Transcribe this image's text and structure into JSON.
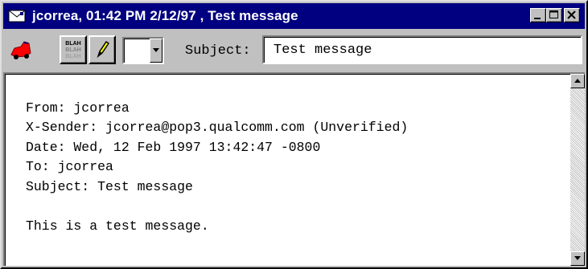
{
  "window": {
    "title": "jcorrea, 01:42 PM 2/12/97 , Test message",
    "title_icon": "envelope-icon",
    "buttons": [
      "minimize-icon",
      "maximize-icon",
      "close-icon"
    ]
  },
  "toolbar": {
    "tools": [
      {
        "name": "priority-car-icon"
      },
      {
        "name": "blah-blah-icon"
      },
      {
        "name": "pencil-edit-icon"
      }
    ],
    "combo_value": "",
    "subject_label": "Subject:",
    "subject_value": "Test message"
  },
  "message": {
    "lines": [
      "From: jcorrea",
      "X-Sender: jcorrea@pop3.qualcomm.com (Unverified)",
      "Date: Wed, 12 Feb 1997 13:42:47 -0800",
      "To: jcorrea",
      "Subject: Test message",
      "",
      "This is a test message."
    ]
  },
  "colors": {
    "titlebar": "#000080",
    "face": "#c0c0c0",
    "car_red": "#ff0000"
  }
}
